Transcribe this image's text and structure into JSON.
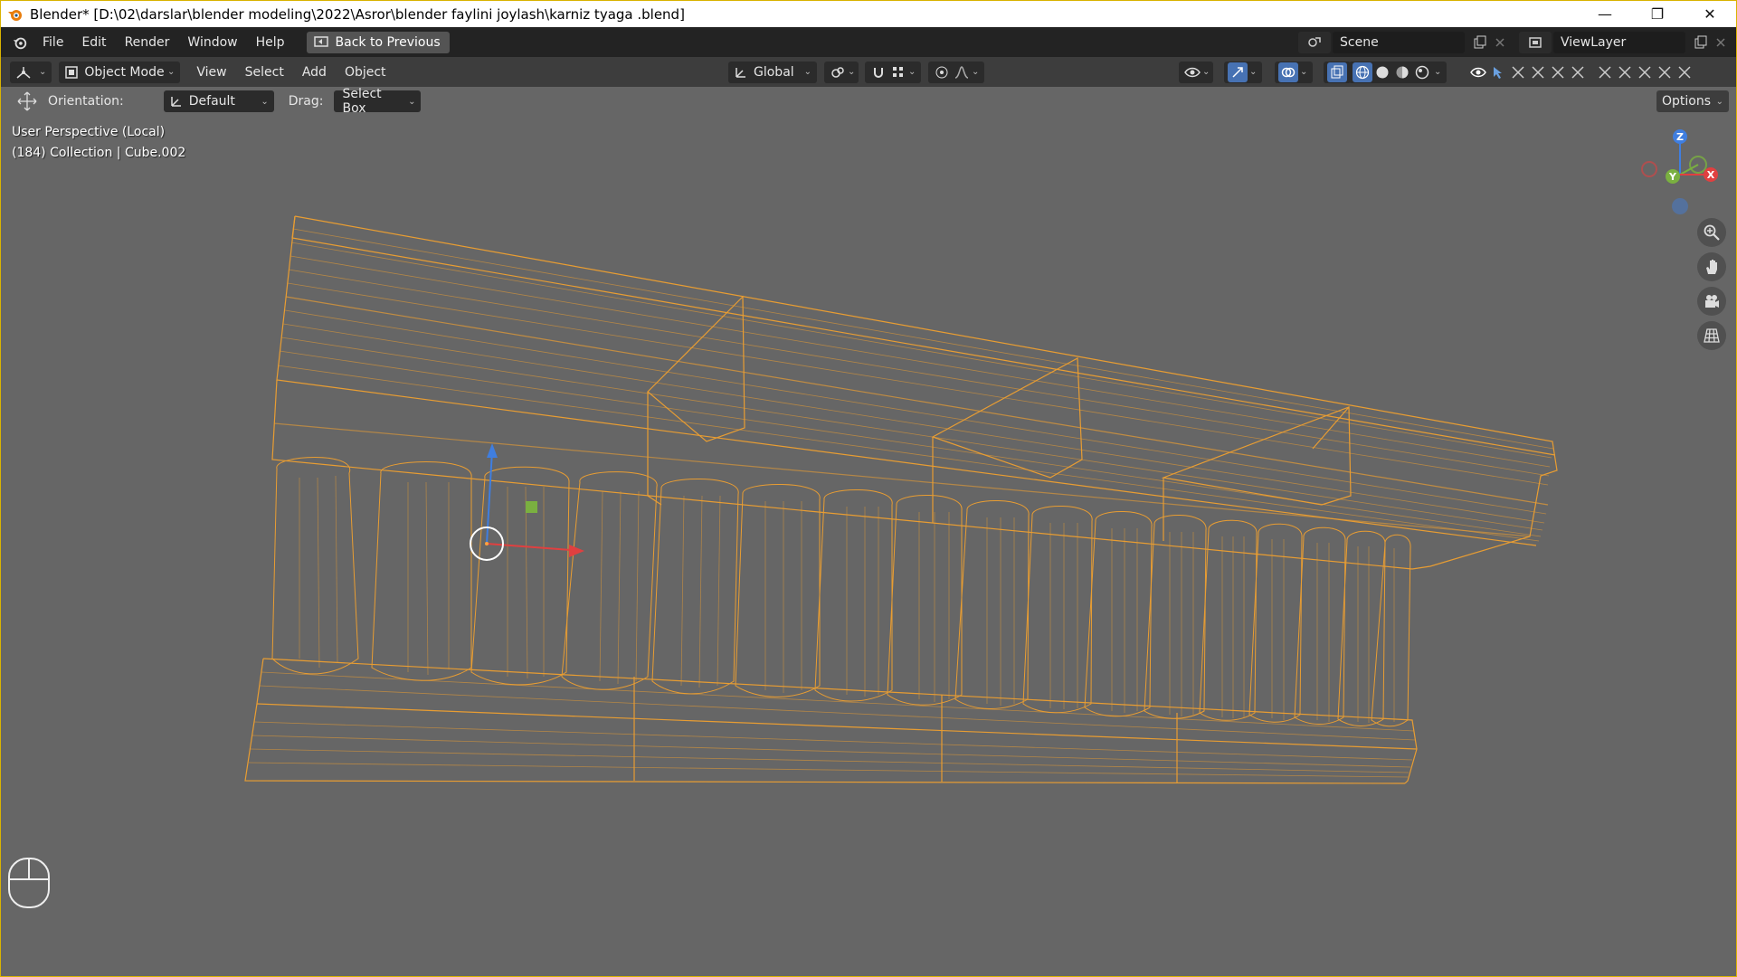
{
  "window": {
    "title": "Blender* [D:\\02\\darslar\\blender modeling\\2022\\Asror\\blender faylini joylash\\karniz tyaga .blend]",
    "minimize_glyph": "—",
    "maximize_glyph": "❐",
    "close_glyph": "✕"
  },
  "topbar": {
    "menus": [
      "File",
      "Edit",
      "Render",
      "Window",
      "Help"
    ],
    "back_button": "Back to Previous",
    "scene_name": "Scene",
    "view_layer": "ViewLayer"
  },
  "viewport_header": {
    "mode": "Object Mode",
    "menus": [
      "View",
      "Select",
      "Add",
      "Object"
    ],
    "transform_orientation": "Global"
  },
  "tool_settings": {
    "orientation_label": "Orientation:",
    "orientation_value": "Default",
    "drag_label": "Drag:",
    "drag_value": "Select Box",
    "options_label": "Options"
  },
  "viewport": {
    "perspective_label": "User Perspective (Local)",
    "collection_label": "(184) Collection | Cube.002",
    "axis_labels": {
      "z": "Z",
      "y": "Y",
      "x": "X"
    },
    "wireframe_color": "#f0a030"
  },
  "icons": {
    "blender": "blender-logo-icon",
    "editor_type": "viewport-editor-icon",
    "mouse": "mouse-icon",
    "zoom": "zoom-icon",
    "pan": "hand-icon",
    "camera": "camera-icon",
    "grid": "grid-icon"
  }
}
